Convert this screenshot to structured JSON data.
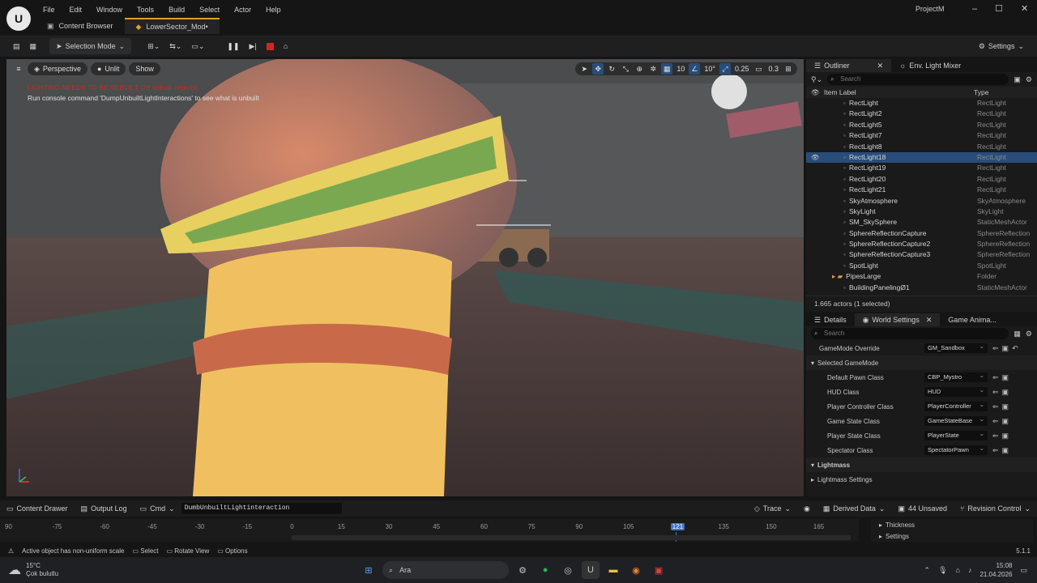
{
  "menu": [
    "File",
    "Edit",
    "Window",
    "Tools",
    "Build",
    "Select",
    "Actor",
    "Help"
  ],
  "project_name": "ProjectM",
  "tabs": [
    {
      "label": "Content Browser",
      "icon": "folder-icon"
    },
    {
      "label": "LowerSector_Mod•",
      "icon": "level-icon"
    }
  ],
  "toolbar": {
    "selection_mode": "Selection Mode",
    "settings": "Settings"
  },
  "viewport": {
    "perspective": "Perspective",
    "unlit": "Unlit",
    "show": "Show",
    "warning": "LIGHTING NEEDS TO BE REBUILT (28 unbuilt objects)",
    "hint": "Run console command 'DumpUnbuiltLightInteractions' to see what is unbuilt",
    "grid_snap": "10",
    "rot_snap": "10°",
    "scale_snap": "0.25",
    "cam_speed": "0.3"
  },
  "outliner": {
    "tab": "Outliner",
    "tab2": "Env. Light Mixer",
    "search_placeholder": "Search",
    "col_label": "Item Label",
    "col_type": "Type",
    "rows": [
      {
        "label": "RectLight",
        "type": "RectLight"
      },
      {
        "label": "RectLight2",
        "type": "RectLight"
      },
      {
        "label": "RectLight5",
        "type": "RectLight"
      },
      {
        "label": "RectLight7",
        "type": "RectLight"
      },
      {
        "label": "RectLight8",
        "type": "RectLight"
      },
      {
        "label": "RectLight18",
        "type": "RectLight",
        "selected": true
      },
      {
        "label": "RectLight19",
        "type": "RectLight"
      },
      {
        "label": "RectLight20",
        "type": "RectLight"
      },
      {
        "label": "RectLight21",
        "type": "RectLight"
      },
      {
        "label": "SkyAtmosphere",
        "type": "SkyAtmosphere"
      },
      {
        "label": "SkyLight",
        "type": "SkyLight"
      },
      {
        "label": "SM_SkySphere",
        "type": "StaticMeshActor"
      },
      {
        "label": "SphereReflectionCapture",
        "type": "SphereReflection"
      },
      {
        "label": "SphereReflectionCapture2",
        "type": "SphereReflection"
      },
      {
        "label": "SphereReflectionCapture3",
        "type": "SphereReflection"
      },
      {
        "label": "SpotLight",
        "type": "SpotLight"
      },
      {
        "label": "PipesLarge",
        "type": "Folder",
        "folder": true
      },
      {
        "label": "BuildingPanelingØ1",
        "type": "StaticMeshActor"
      }
    ],
    "footer": "1.665 actors (1 selected)"
  },
  "details": {
    "tab": "Details",
    "tab2": "World Settings",
    "tab3": "Game Anima...",
    "search_placeholder": "Search",
    "gamemode_override_label": "GameMode Override",
    "gamemode_override": "GM_Sandbox",
    "selected_gamemode": "Selected GameMode",
    "rows": [
      {
        "label": "Default Pawn Class",
        "value": "CBP_Mystro"
      },
      {
        "label": "HUD Class",
        "value": "HUD"
      },
      {
        "label": "Player Controller Class",
        "value": "PlayerController"
      },
      {
        "label": "Game State Class",
        "value": "GameStateBase"
      },
      {
        "label": "Player State Class",
        "value": "PlayerState"
      },
      {
        "label": "Spectator Class",
        "value": "SpectatorPawn"
      }
    ],
    "lightmass": "Lightmass",
    "lightmass_settings": "Lightmass Settings"
  },
  "bottombar": {
    "content_drawer": "Content Drawer",
    "output_log": "Output Log",
    "cmd": "Cmd",
    "cmd_value": "DumbUnbuiltLightinteraction",
    "trace": "Trace",
    "derived_data": "Derived Data",
    "unsaved": "44 Unsaved",
    "revision": "Revision Control"
  },
  "timeline": {
    "ticks": [
      "90",
      "-75",
      "-60",
      "-45",
      "-30",
      "-15",
      "0",
      "15",
      "30",
      "45",
      "60",
      "75",
      "90",
      "105",
      "121",
      "135",
      "150",
      "165"
    ],
    "current": "121",
    "thickness": "Thickness",
    "settings": "Settings"
  },
  "status": {
    "left": "Active object has non-uniform scale",
    "select": "Select",
    "rotate": "Rotate View",
    "options": "Options",
    "version": "5.1.1"
  },
  "taskbar": {
    "temp": "15°C",
    "weather": "Çok bulutlu",
    "search": "Ara",
    "time": "15:08",
    "date": "21.04.2026"
  }
}
